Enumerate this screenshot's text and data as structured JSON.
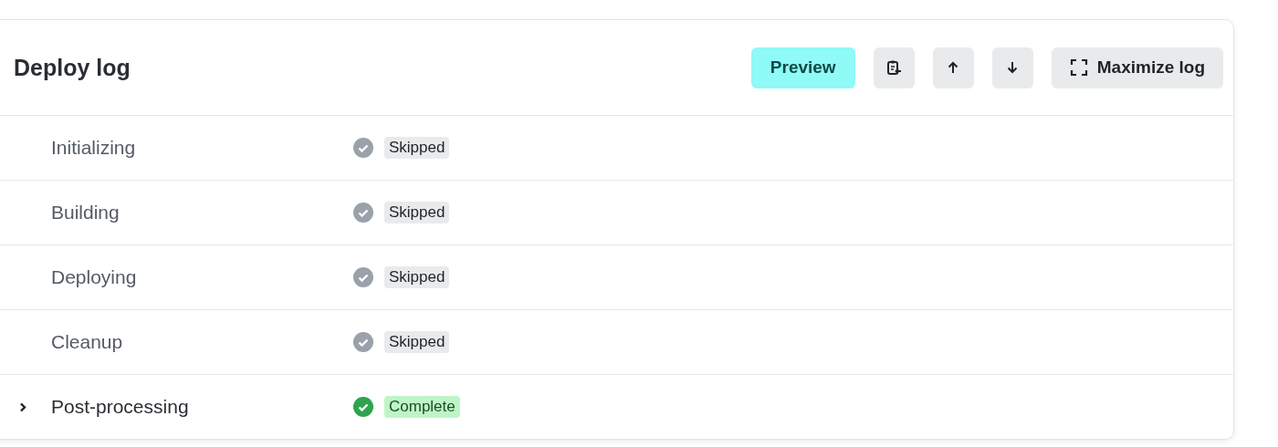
{
  "header": {
    "title": "Deploy log",
    "preview": "Preview",
    "maximize": "Maximize log"
  },
  "steps": [
    {
      "name": "Initializing",
      "kind": "skipped",
      "badge": "Skipped",
      "expandable": false
    },
    {
      "name": "Building",
      "kind": "skipped",
      "badge": "Skipped",
      "expandable": false
    },
    {
      "name": "Deploying",
      "kind": "skipped",
      "badge": "Skipped",
      "expandable": false
    },
    {
      "name": "Cleanup",
      "kind": "skipped",
      "badge": "Skipped",
      "expandable": false
    },
    {
      "name": "Post-processing",
      "kind": "complete",
      "badge": "Complete",
      "expandable": true
    }
  ]
}
